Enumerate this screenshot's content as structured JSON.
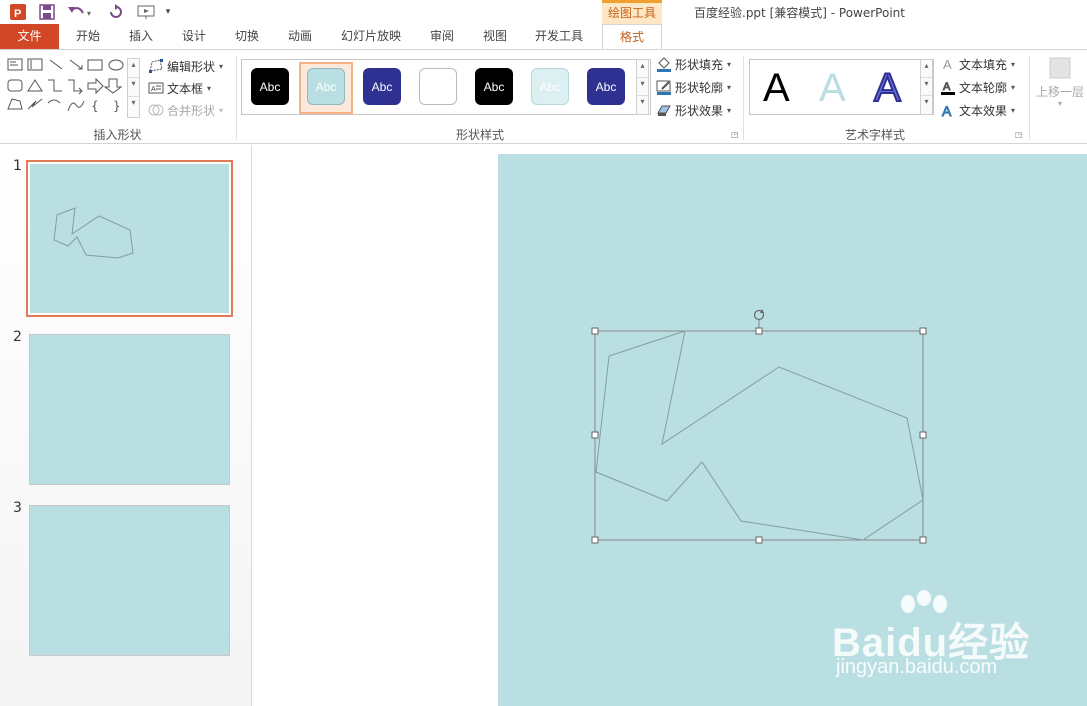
{
  "window": {
    "title": "百度经验.ppt [兼容模式] - PowerPoint",
    "context_tab_group": "绘图工具"
  },
  "tabs": [
    {
      "label": "文件"
    },
    {
      "label": "开始"
    },
    {
      "label": "插入"
    },
    {
      "label": "设计"
    },
    {
      "label": "切换"
    },
    {
      "label": "动画"
    },
    {
      "label": "幻灯片放映"
    },
    {
      "label": "审阅"
    },
    {
      "label": "视图"
    },
    {
      "label": "开发工具"
    },
    {
      "label": "格式"
    }
  ],
  "ribbon": {
    "insert_shapes": {
      "label": "插入形状",
      "edit_shape": "编辑形状",
      "text_box": "文本框",
      "merge_shapes": "合并形状"
    },
    "shape_styles": {
      "label": "形状样式",
      "swatch_text": "Abc",
      "fill": "形状填充",
      "outline": "形状轮廓",
      "effects": "形状效果"
    },
    "wordart_styles": {
      "label": "艺术字样式",
      "letter": "A",
      "text_fill": "文本填充",
      "text_outline": "文本轮廓",
      "text_effects": "文本效果"
    },
    "arrange": {
      "bring_forward": "上移一层"
    }
  },
  "thumbnails": [
    {
      "number": "1"
    },
    {
      "number": "2"
    },
    {
      "number": "3"
    }
  ],
  "colors": {
    "accent_file": "#d24726",
    "slide_bg": "#badfe2",
    "selection_orange": "#e27a56"
  },
  "watermark": {
    "main": "Baidu经验",
    "sub": "jingyan.baidu.com"
  }
}
